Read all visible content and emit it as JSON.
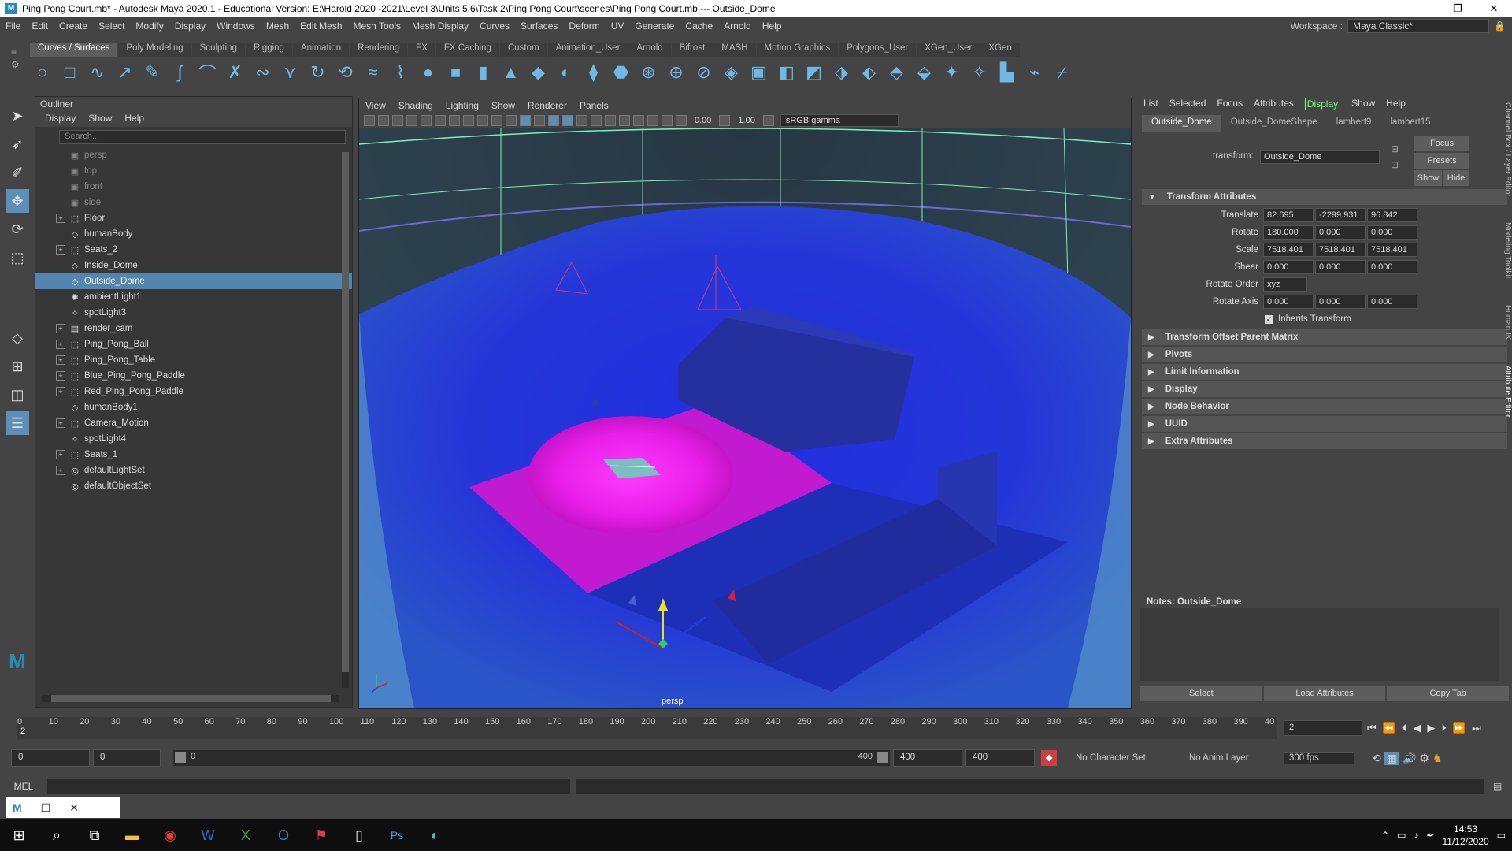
{
  "title": {
    "text": "Ping Pong Court.mb* - Autodesk Maya 2020.1 - Educational Version: E:\\Harold 2020 -2021\\Level 3\\Units 5,6\\Task 2\\Ping Pong Court\\scenes\\Ping Pong Court.mb  ---  Outside_Dome",
    "icon": "M"
  },
  "window_controls": {
    "minimize": "–",
    "restore": "❐",
    "close": "✕"
  },
  "menubar": {
    "items": [
      "File",
      "Edit",
      "Create",
      "Select",
      "Modify",
      "Display",
      "Windows",
      "Mesh",
      "Edit Mesh",
      "Mesh Tools",
      "Mesh Display",
      "Curves",
      "Surfaces",
      "Deform",
      "UV",
      "Generate",
      "Cache",
      "Arnold",
      "Help"
    ],
    "workspace_label": "Workspace :",
    "workspace_value": "Maya Classic*"
  },
  "shelf": {
    "tabs": [
      "Curves / Surfaces",
      "Poly Modeling",
      "Sculpting",
      "Rigging",
      "Animation",
      "Rendering",
      "FX",
      "FX Caching",
      "Custom",
      "Animation_User",
      "Arnold",
      "Bifrost",
      "MASH",
      "Motion Graphics",
      "Polygons_User",
      "XGen_User",
      "XGen"
    ],
    "active_tab": 0,
    "icons": [
      "circle-icon",
      "square-icon",
      "cv-curve-icon",
      "ep-curve-icon",
      "pencil-curve-icon",
      "bezier-icon",
      "arc-icon",
      "curve-fit-icon",
      "attach-icon",
      "detach-icon",
      "rebuild-icon",
      "reverse-icon",
      "offset-icon",
      "project-icon",
      "sphere-icon",
      "cube-icon",
      "cylinder-icon",
      "cone-icon",
      "plane-icon",
      "torus-icon",
      "loft-icon",
      "extrude-icon",
      "revolve-icon",
      "birail-icon",
      "trim-icon",
      "boundary-icon",
      "square-surface-icon",
      "bevel-icon",
      "planar-icon",
      "insert-isoparm-icon",
      "detach-surface-icon",
      "rebuild-surface-icon",
      "sculpt-icon",
      "stitch-icon",
      "round-icon",
      "fillet-icon",
      "paint-icon",
      "smooth-icon"
    ]
  },
  "left_tools": [
    "select-arrow-icon",
    "lasso-icon",
    "paint-select-icon",
    "move-icon",
    "rotate-icon",
    "scale-icon"
  ],
  "outliner": {
    "header": "Outliner",
    "menu": [
      "Display",
      "Show",
      "Help"
    ],
    "search_placeholder": "Search...",
    "items": [
      {
        "label": "persp",
        "icon": "camera-icon",
        "expand": false,
        "dim": true
      },
      {
        "label": "top",
        "icon": "camera-icon",
        "expand": false,
        "dim": true
      },
      {
        "label": "front",
        "icon": "camera-icon",
        "expand": false,
        "dim": true
      },
      {
        "label": "side",
        "icon": "camera-icon",
        "expand": false,
        "dim": true
      },
      {
        "label": "Floor",
        "icon": "group-icon",
        "expand": true
      },
      {
        "label": "humanBody",
        "icon": "mesh-icon",
        "expand": false
      },
      {
        "label": "Seats_2",
        "icon": "group-icon",
        "expand": true
      },
      {
        "label": "Inside_Dome",
        "icon": "mesh-icon",
        "expand": false
      },
      {
        "label": "Outside_Dome",
        "icon": "mesh-icon",
        "expand": false,
        "selected": true
      },
      {
        "label": "ambientLight1",
        "icon": "ambient-light-icon",
        "expand": false
      },
      {
        "label": "spotLight3",
        "icon": "spot-light-icon",
        "expand": false
      },
      {
        "label": "render_cam",
        "icon": "camera-group-icon",
        "expand": true
      },
      {
        "label": "Ping_Pong_Ball",
        "icon": "group-icon",
        "expand": true
      },
      {
        "label": "Ping_Pong_Table",
        "icon": "group-icon",
        "expand": true
      },
      {
        "label": "Blue_Ping_Pong_Paddle",
        "icon": "group-icon",
        "expand": true
      },
      {
        "label": "Red_Ping_Pong_Paddle",
        "icon": "group-icon",
        "expand": true
      },
      {
        "label": "humanBody1",
        "icon": "mesh-icon",
        "expand": false
      },
      {
        "label": "Camera_Motion",
        "icon": "group-icon",
        "expand": true
      },
      {
        "label": "spotLight4",
        "icon": "spot-light-icon",
        "expand": false
      },
      {
        "label": "Seats_1",
        "icon": "group-icon",
        "expand": true
      },
      {
        "label": "defaultLightSet",
        "icon": "set-icon",
        "expand": true
      },
      {
        "label": "defaultObjectSet",
        "icon": "set-icon",
        "expand": false
      }
    ]
  },
  "viewport": {
    "menu": [
      "View",
      "Shading",
      "Lighting",
      "Show",
      "Renderer",
      "Panels"
    ],
    "exposure": "0.00",
    "gamma": "1.00",
    "color_space": "sRGB gamma",
    "camera_label": "persp"
  },
  "attribute_editor": {
    "menu": [
      "List",
      "Selected",
      "Focus",
      "Attributes",
      "Display",
      "Show",
      "Help"
    ],
    "tabs": [
      "Outside_Dome",
      "Outside_DomeShape",
      "lambert9",
      "lambert15"
    ],
    "transform_label": "transform:",
    "transform_value": "Outside_Dome",
    "buttons": {
      "focus": "Focus",
      "presets": "Presets",
      "show": "Show",
      "hide": "Hide"
    },
    "section_transform": "Transform Attributes",
    "translate": {
      "label": "Translate",
      "x": "82.695",
      "y": "-2299.931",
      "z": "96.842"
    },
    "rotate": {
      "label": "Rotate",
      "x": "180.000",
      "y": "0.000",
      "z": "0.000"
    },
    "scale": {
      "label": "Scale",
      "x": "7518.401",
      "y": "7518.401",
      "z": "7518.401"
    },
    "shear": {
      "label": "Shear",
      "x": "0.000",
      "y": "0.000",
      "z": "0.000"
    },
    "rotate_order": {
      "label": "Rotate Order",
      "value": "xyz"
    },
    "rotate_axis": {
      "label": "Rotate Axis",
      "x": "0.000",
      "y": "0.000",
      "z": "0.000"
    },
    "inherits_transform": "Inherits Transform",
    "collapsed_sections": [
      "Transform Offset Parent Matrix",
      "Pivots",
      "Limit Information",
      "Display",
      "Node Behavior",
      "UUID",
      "Extra Attributes"
    ],
    "notes_label": "Notes:  Outside_Dome",
    "bottom_buttons": [
      "Select",
      "Load Attributes",
      "Copy Tab"
    ]
  },
  "side_tabs": [
    "Channel Box / Layer Editor",
    "Modeling Toolkit",
    "Human IK",
    "Attribute Editor"
  ],
  "timeline": {
    "ticks": [
      "0",
      "10",
      "20",
      "30",
      "40",
      "50",
      "60",
      "70",
      "80",
      "90",
      "100",
      "110",
      "120",
      "130",
      "140",
      "150",
      "160",
      "170",
      "180",
      "190",
      "200",
      "210",
      "220",
      "230",
      "240",
      "250",
      "260",
      "270",
      "280",
      "290",
      "300",
      "310",
      "320",
      "330",
      "340",
      "350",
      "360",
      "370",
      "380",
      "390",
      "40"
    ],
    "current_frame": "2",
    "current_marker": "2"
  },
  "range": {
    "start": "0",
    "start2": "0",
    "slider_start": "0",
    "slider_end": "400",
    "end": "400",
    "end2": "400",
    "character_set": "No Character Set",
    "anim_layer": "No Anim Layer",
    "fps": "300 fps"
  },
  "mel": {
    "label": "MEL"
  },
  "taskbar": {
    "apps": [
      "windows-start-icon",
      "search-icon",
      "task-view-icon",
      "file-explorer-icon",
      "chrome-icon",
      "word-icon",
      "excel-icon",
      "outlook-icon",
      "autodesk-icon",
      "notepad-icon",
      "photoshop-icon",
      "edge-icon"
    ],
    "time": "14:53",
    "date": "11/12/2020"
  }
}
